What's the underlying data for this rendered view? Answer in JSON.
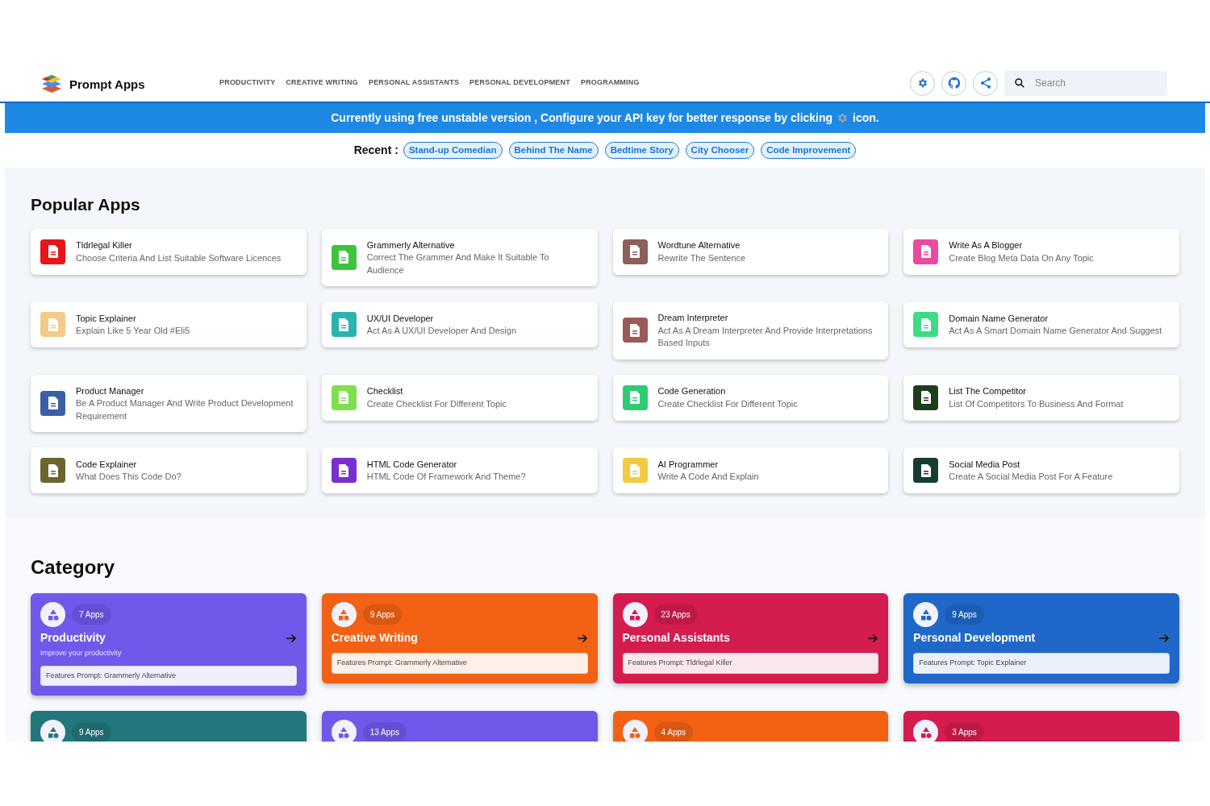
{
  "header": {
    "logo": "Prompt Apps",
    "nav": [
      "PRODUCTIVITY",
      "CREATIVE WRITING",
      "PERSONAL ASSISTANTS",
      "PERSONAL DEVELOPMENT",
      "PROGRAMMING"
    ],
    "search": {
      "placeholder": "Search"
    }
  },
  "banner": {
    "text": "Currently using free unstable version , Configure your API key for better response by clicking",
    "suffix": "icon."
  },
  "recent": {
    "label": "Recent :",
    "items": [
      "Stand-up Comedian",
      "Behind The Name",
      "Bedtime Story",
      "City Chooser",
      "Code Improvement"
    ]
  },
  "popular": {
    "title": "Popular Apps",
    "apps": [
      {
        "name": "Tldrlegal Killer",
        "description": "Choose Criteria And List Suitable Software Licences",
        "color": "#e8151b"
      },
      {
        "name": "Grammerly Alternative",
        "description": "Correct The Grammer And Make It Suitable To Audience",
        "color": "#3dc43d"
      },
      {
        "name": "Wordtune Alternative",
        "description": "Rewrite The Sentence",
        "color": "#8b5f5a"
      },
      {
        "name": "Write As A Blogger",
        "description": "Create Blog Meta Data On Any Topic",
        "color": "#e94ba0"
      },
      {
        "name": "Topic Explainer",
        "description": "Explain Like 5 Year Old #Eli5",
        "color": "#f5c98a"
      },
      {
        "name": "UX/UI Developer",
        "description": "Act As A UX/UI Developer And Design",
        "color": "#2bb3b0"
      },
      {
        "name": "Dream Interpreter",
        "description": "Act As A Dream Interpreter And Provide Interpretations Based Inputs",
        "color": "#9b5a55"
      },
      {
        "name": "Domain Name Generator",
        "description": "Act As A Smart Domain Name Generator And Suggest",
        "color": "#3ddc84"
      },
      {
        "name": "Product Manager",
        "description": "Be A Product Manager And Write Product Development Requirement",
        "color": "#3a5fa8"
      },
      {
        "name": "Checklist",
        "description": "Create Checklist For Different Topic",
        "color": "#7ee04a"
      },
      {
        "name": "Code Generation",
        "description": "Create Checklist For Different Topic",
        "color": "#2ecc71"
      },
      {
        "name": "List The Competitor",
        "description": "List Of Competitors To Business And Format",
        "color": "#1e3d1e"
      },
      {
        "name": "Code Explainer",
        "description": "What Does This Code Do?",
        "color": "#6b6630"
      },
      {
        "name": "HTML Code Generator",
        "description": "HTML Code Of Framework And Theme?",
        "color": "#7b2fd0"
      },
      {
        "name": "AI Programmer",
        "description": "Write A Code And Explain",
        "color": "#f2cc40"
      },
      {
        "name": "Social Media Post",
        "description": "Create A Social Media Post For A Feature",
        "color": "#163d33"
      }
    ]
  },
  "category": {
    "title": "Category",
    "cards": [
      {
        "count": "7 Apps",
        "title": "Productivity",
        "subtitle": "Improve your productivity",
        "feature": "Features Prompt: Grammerly Alternative",
        "color": "#6f59eb"
      },
      {
        "count": "9 Apps",
        "title": "Creative Writing",
        "feature": "Features Prompt: Grammerly Alternative",
        "color": "#f26114"
      },
      {
        "count": "23 Apps",
        "title": "Personal Assistants",
        "feature": "Features Prompt: Tldrlegal Killer",
        "color": "#d41c4e"
      },
      {
        "count": "9 Apps",
        "title": "Personal Development",
        "feature": "Features Prompt: Topic Explainer",
        "color": "#1f68c9"
      },
      {
        "count": "9 Apps",
        "color": "#22777d"
      },
      {
        "count": "13 Apps",
        "color": "#6f59eb"
      },
      {
        "count": "4 Apps",
        "color": "#f26114"
      },
      {
        "count": "3 Apps",
        "color": "#d41c4e"
      }
    ]
  }
}
